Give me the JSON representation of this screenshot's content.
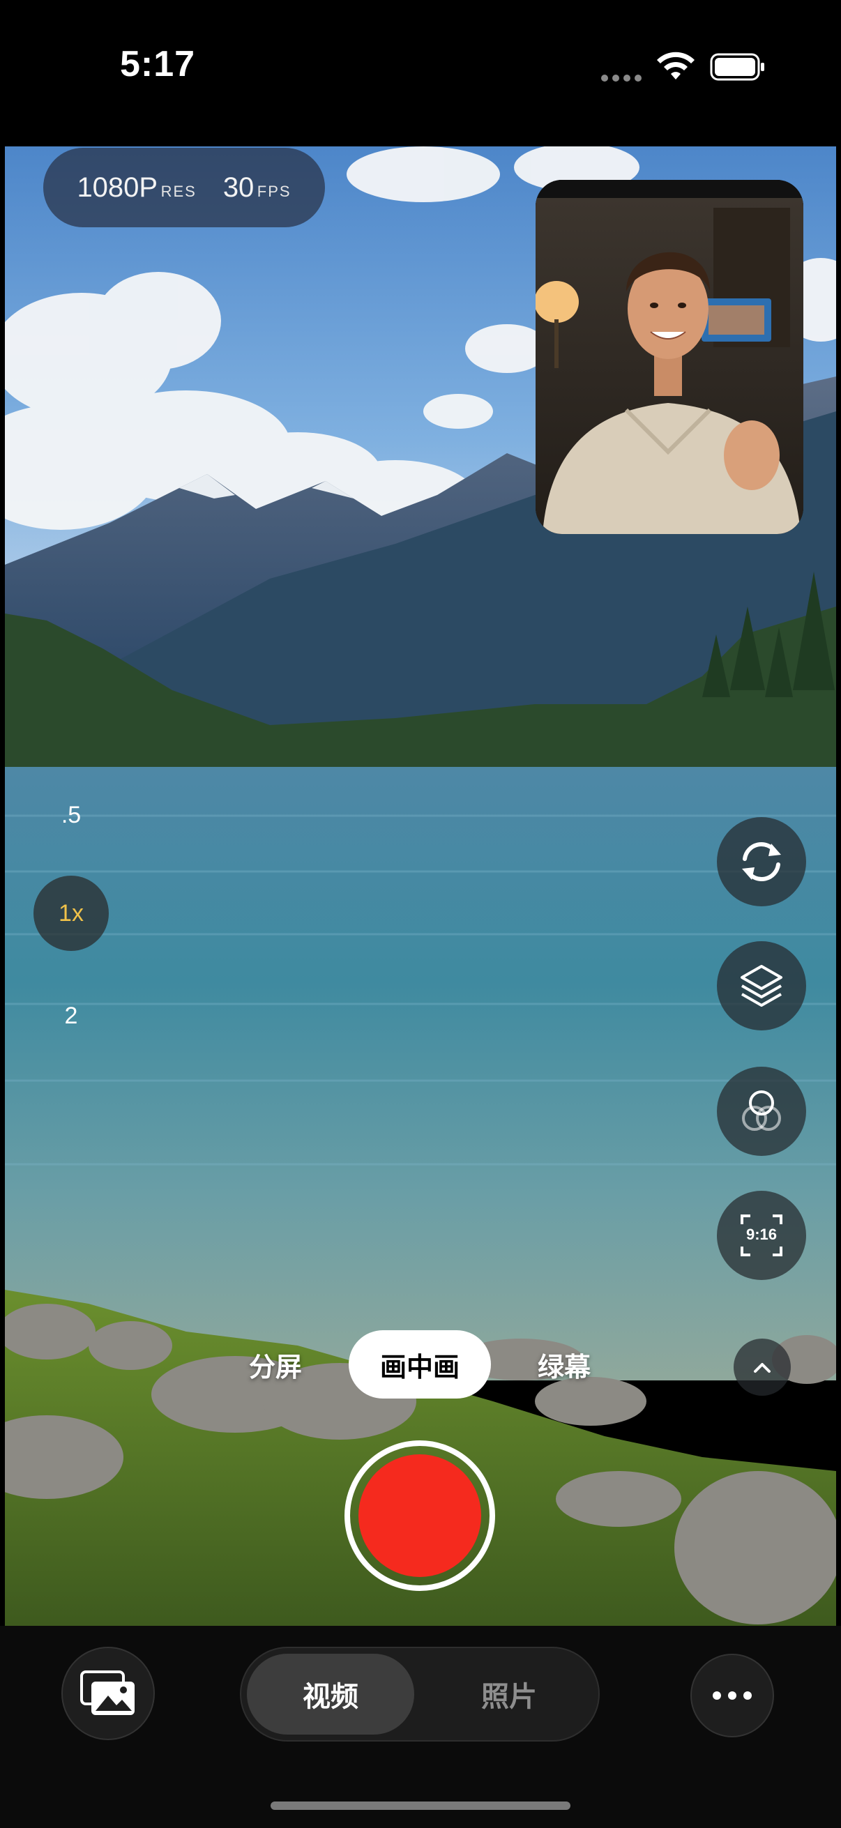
{
  "status_bar": {
    "time": "5:17",
    "icons": [
      "signal-dots-icon",
      "wifi-icon",
      "battery-icon"
    ]
  },
  "camera": {
    "resolution": {
      "value": "1080P",
      "unit": "RES"
    },
    "framerate": {
      "value": "30",
      "unit": "FPS"
    },
    "zoom_levels": [
      ".5",
      "1x",
      "2"
    ],
    "selected_zoom": "1x",
    "side_controls": [
      "flip-camera-icon",
      "layers-icon",
      "filter-circles-icon",
      "aspect-ratio-icon"
    ],
    "aspect_ratio_label": "9:16",
    "expand_icon": "chevron-up-icon"
  },
  "modes": {
    "items": [
      "分屏",
      "画中画",
      "绿幕"
    ],
    "active": "画中画"
  },
  "bottom_bar": {
    "gallery_icon": "photo-gallery-icon",
    "segments": [
      "视频",
      "照片"
    ],
    "active_segment": "视频",
    "more_icon": "more-dots-icon"
  },
  "colors": {
    "record": "#f52a1e",
    "zoom_active": "#f0c24a",
    "mode_active_bg": "#ffffff"
  }
}
